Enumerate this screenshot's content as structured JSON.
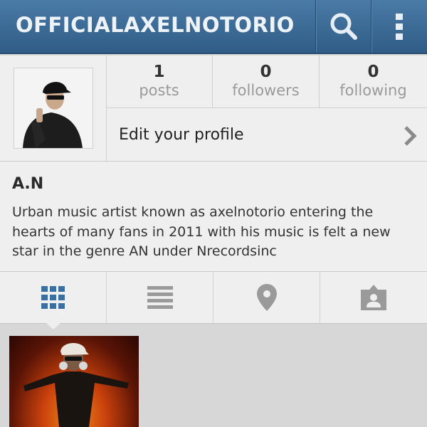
{
  "header": {
    "title": "OFFICIALAXELNOTORIO",
    "search_icon": "search-icon",
    "menu_icon": "overflow-menu-icon",
    "bg_color": "#3a6a96"
  },
  "profile": {
    "avatar_icon": "profile-photo",
    "stats": {
      "posts": {
        "value": "1",
        "label": "posts"
      },
      "followers": {
        "value": "0",
        "label": "followers"
      },
      "following": {
        "value": "0",
        "label": "following"
      }
    },
    "edit_label": "Edit your profile",
    "edit_chevron_icon": "chevron-right-icon"
  },
  "bio": {
    "name": "A.N",
    "text": "Urban music artist known as axelnotorio entering the hearts of many fans in 2011 with his music is felt a new star in the genre AN under Nrecordsinc"
  },
  "tabs": [
    {
      "icon": "grid-view-icon",
      "active": true
    },
    {
      "icon": "list-view-icon",
      "active": false
    },
    {
      "icon": "map-pin-icon",
      "active": false
    },
    {
      "icon": "tagged-photos-icon",
      "active": false
    }
  ],
  "posts_grid": {
    "count": 1,
    "active_color": "#3b6fa0"
  }
}
